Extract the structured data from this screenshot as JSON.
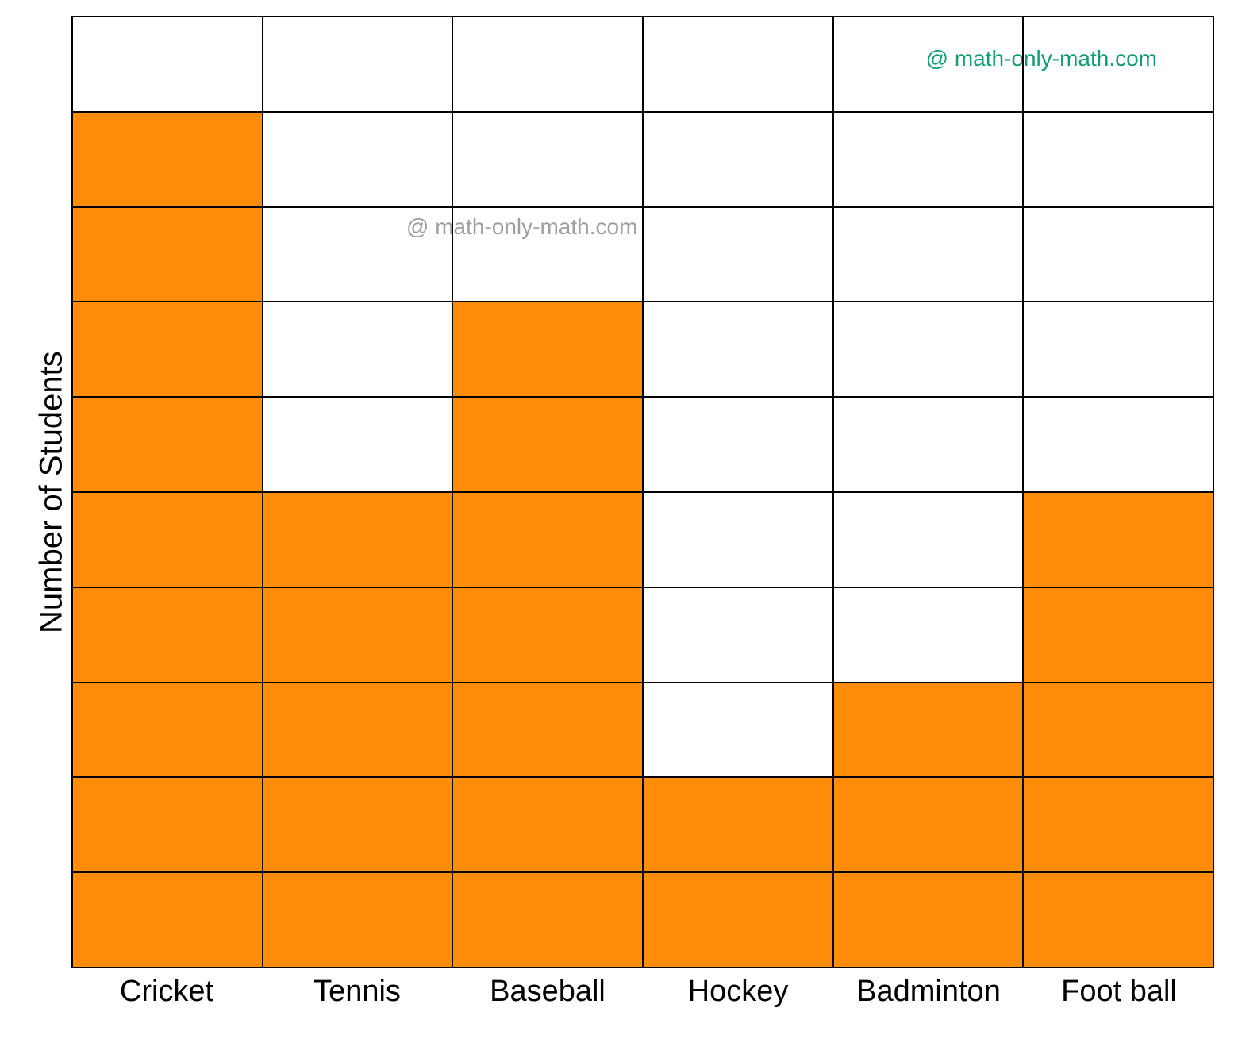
{
  "chart_data": {
    "type": "bar",
    "categories": [
      "Cricket",
      "Tennis",
      "Baseball",
      "Hockey",
      "Badminton",
      "Foot ball"
    ],
    "values": [
      9,
      5,
      7,
      2,
      3,
      5
    ],
    "ylabel": "Number of Students",
    "xlabel": "",
    "ylim": [
      0,
      10
    ],
    "title": "",
    "bar_color": "#ff8d0a"
  },
  "watermarks": {
    "top_right": "@ math-only-math.com",
    "middle": "@ math-only-math.com",
    "left": "@ math-only-math.com",
    "bottom_right": "@ math-only-math.com"
  }
}
